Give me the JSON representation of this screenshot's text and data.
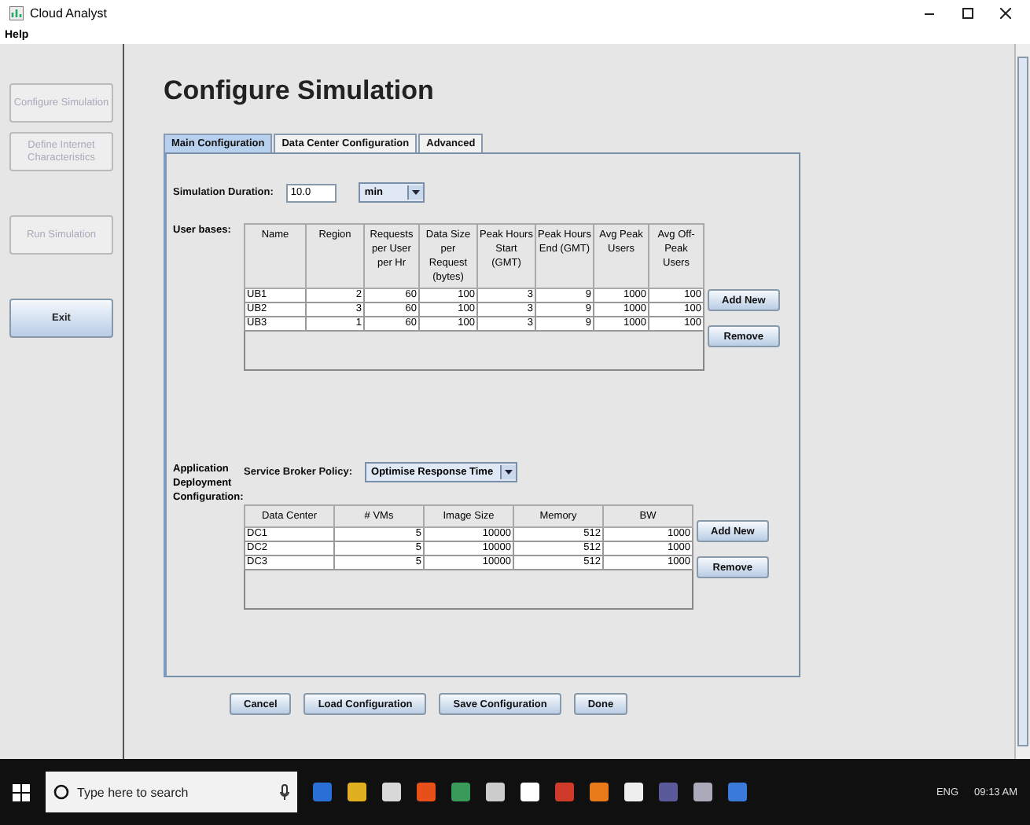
{
  "window": {
    "title": "Cloud Analyst"
  },
  "menu": [
    "Help"
  ],
  "sidebar": [
    {
      "label": "Configure Simulation",
      "disabled": true
    },
    {
      "label": "Define Internet Characteristics",
      "disabled": true
    },
    {
      "label": "Run Simulation",
      "disabled": true
    },
    {
      "label": "Exit",
      "disabled": false
    }
  ],
  "heading": "Configure Simulation",
  "tabs": [
    {
      "label": "Main Configuration",
      "selected": true
    },
    {
      "label": "Data Center Configuration",
      "selected": false
    },
    {
      "label": "Advanced",
      "selected": false
    }
  ],
  "duration": {
    "label": "Simulation Duration:",
    "value": "10.0",
    "unit": "min"
  },
  "user_bases": {
    "label": "User bases:",
    "columns": [
      "Name",
      "Region",
      "Requests per User per Hr",
      "Data Size per Request (bytes)",
      "Peak Hours Start (GMT)",
      "Peak Hours End (GMT)",
      "Avg Peak Users",
      "Avg Off-Peak Users"
    ],
    "rows": [
      [
        "UB1",
        "2",
        "60",
        "100",
        "3",
        "9",
        "1000",
        "100"
      ],
      [
        "UB2",
        "3",
        "60",
        "100",
        "3",
        "9",
        "1000",
        "100"
      ],
      [
        "UB3",
        "1",
        "60",
        "100",
        "3",
        "9",
        "1000",
        "100"
      ]
    ],
    "buttons": [
      "Add New",
      "Remove"
    ]
  },
  "deployment": {
    "label": "Application Deployment Configuration:",
    "policy_label": "Service Broker Policy:",
    "policy": "Optimise Response Time",
    "columns": [
      "Data Center",
      "# VMs",
      "Image Size",
      "Memory",
      "BW"
    ],
    "rows": [
      [
        "DC1",
        "5",
        "10000",
        "512",
        "1000"
      ],
      [
        "DC2",
        "5",
        "10000",
        "512",
        "1000"
      ],
      [
        "DC3",
        "5",
        "10000",
        "512",
        "1000"
      ]
    ],
    "buttons": [
      "Add New",
      "Remove"
    ]
  },
  "footer_buttons": [
    "Cancel",
    "Load Configuration",
    "Save Configuration",
    "Done"
  ],
  "taskbar": {
    "search_placeholder": "Type here to search",
    "language": "ENG",
    "time": "09:13 AM"
  }
}
